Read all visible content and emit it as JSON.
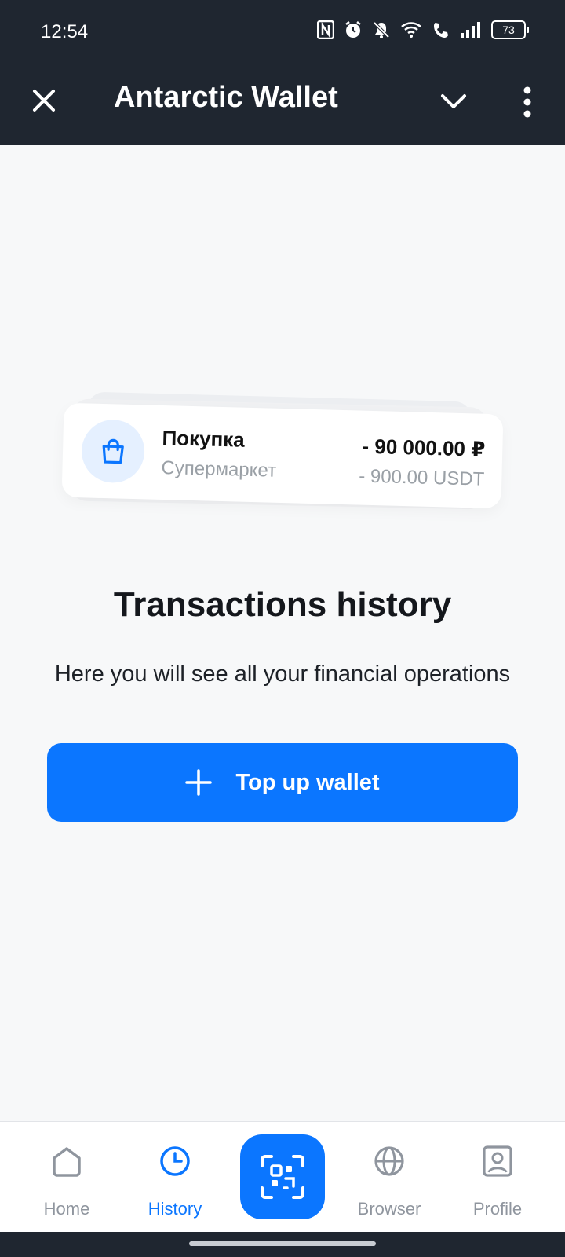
{
  "status_bar": {
    "time": "12:54",
    "battery": "73"
  },
  "app_bar": {
    "title": "Antarctic Wallet",
    "close_icon": "close-icon",
    "dropdown_icon": "chevron-down-icon",
    "menu_icon": "more-vertical-icon"
  },
  "illustration": {
    "title": "Покупка",
    "subtitle": "Супермаркет",
    "amount": "- 90 000.00 ₽",
    "amount_usdt": "- 900.00 USDT",
    "icon": "shopping-bag-icon"
  },
  "main": {
    "heading": "Transactions history",
    "subtext": "Here you will see all your financial operations",
    "topup_label": "Top up wallet"
  },
  "nav": {
    "items": [
      {
        "label": "Home",
        "icon": "home-icon",
        "active": false
      },
      {
        "label": "History",
        "icon": "clock-icon",
        "active": true
      },
      {
        "label": "Browser",
        "icon": "globe-icon",
        "active": false
      },
      {
        "label": "Profile",
        "icon": "profile-icon",
        "active": false
      }
    ],
    "scan_icon": "qr-scan-icon"
  },
  "colors": {
    "accent": "#0b76ff",
    "header_bg": "#1f2630",
    "page_bg": "#f7f8f9"
  }
}
